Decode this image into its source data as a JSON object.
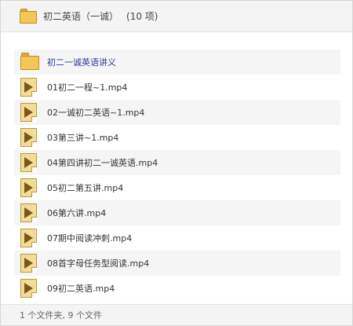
{
  "header": {
    "icon": "folder-icon",
    "title": "初二英语（一诚）",
    "count": "(10 项)"
  },
  "items": [
    {
      "type": "folder",
      "icon": "folder-icon",
      "name": "初二一诚英语讲义"
    },
    {
      "type": "video",
      "icon": "video-file-icon",
      "name": "01初二一程~1.mp4"
    },
    {
      "type": "video",
      "icon": "video-file-icon",
      "name": "02一诚初二英语~1.mp4"
    },
    {
      "type": "video",
      "icon": "video-file-icon",
      "name": "03第三讲~1.mp4"
    },
    {
      "type": "video",
      "icon": "video-file-icon",
      "name": "04第四讲初二一诚英语.mp4"
    },
    {
      "type": "video",
      "icon": "video-file-icon",
      "name": "05初二第五讲.mp4"
    },
    {
      "type": "video",
      "icon": "video-file-icon",
      "name": "06第六讲.mp4"
    },
    {
      "type": "video",
      "icon": "video-file-icon",
      "name": "07期中阅读冲刺.mp4"
    },
    {
      "type": "video",
      "icon": "video-file-icon",
      "name": "08首字母任务型阅读.mp4"
    },
    {
      "type": "video",
      "icon": "video-file-icon",
      "name": "09初二英语.mp4"
    }
  ],
  "footer": {
    "status": "1 个文件夹, 9 个文件"
  },
  "colors": {
    "folder_fill": "#f4c65a",
    "video_fill": "#f3dc9a",
    "folder_name": "#2a3a9c",
    "row_shade": "#f5f5f5"
  }
}
